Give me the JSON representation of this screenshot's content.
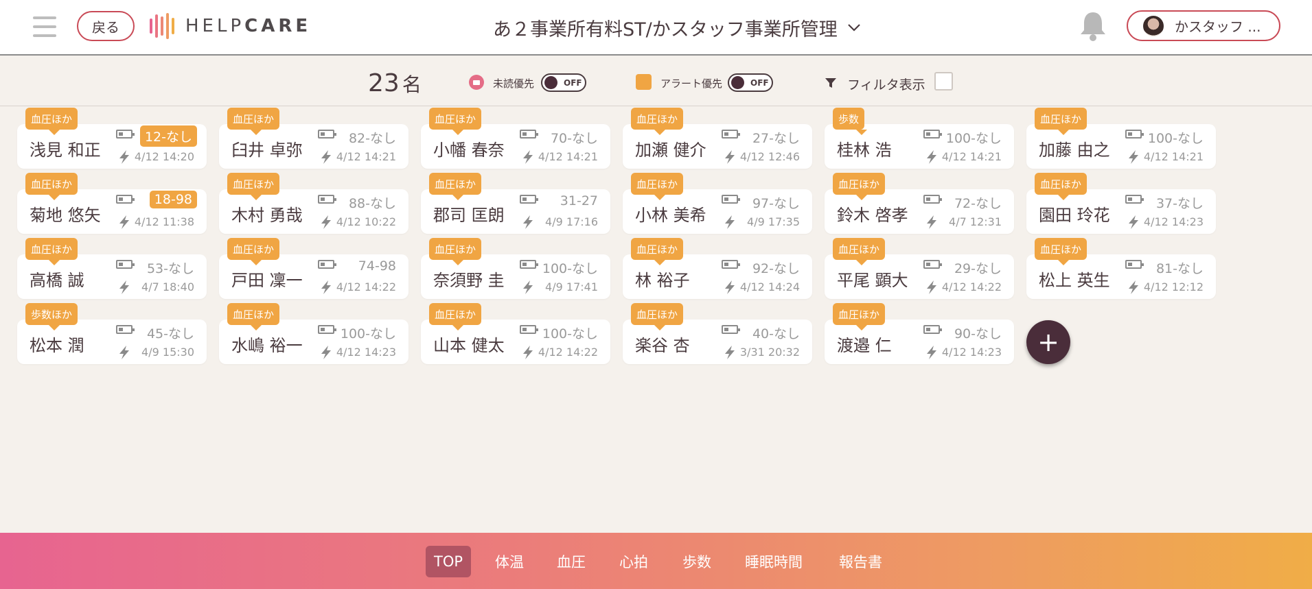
{
  "header": {
    "back_label": "戻る",
    "logo_text_light": "HELP",
    "logo_text_bold": "CARE",
    "facility_name": "あ２事業所有料ST/かスタッフ事業所管理",
    "user_name": "かスタッフ ...",
    "icons": [
      "menu-icon",
      "bell-icon",
      "chevron-down-icon"
    ]
  },
  "filters": {
    "count": "23",
    "count_unit": "名",
    "unread_label": "未読優先",
    "unread_toggle": "OFF",
    "alert_label": "アラート優先",
    "alert_toggle": "OFF",
    "filter_label": "フィルタ表示"
  },
  "colors": {
    "accent": "#f0a543",
    "brand_dark": "#4a2d3a",
    "border_red": "#c94a56",
    "gradient_start": "#e76490",
    "gradient_end": "#f0ad47"
  },
  "residents": [
    {
      "tag": "血圧ほか",
      "name": "浅見 和正",
      "bp": "12-なし",
      "time": "4/12 14:20",
      "alert": true
    },
    {
      "tag": "血圧ほか",
      "name": "臼井 卓弥",
      "bp": "82-なし",
      "time": "4/12 14:21",
      "alert": false
    },
    {
      "tag": "血圧ほか",
      "name": "小幡 春奈",
      "bp": "70-なし",
      "time": "4/12 14:21",
      "alert": false
    },
    {
      "tag": "血圧ほか",
      "name": "加瀬 健介",
      "bp": "27-なし",
      "time": "4/12 12:46",
      "alert": false
    },
    {
      "tag": "歩数",
      "name": "桂林 浩",
      "bp": "100-なし",
      "time": "4/12 14:21",
      "alert": false
    },
    {
      "tag": "血圧ほか",
      "name": "加藤 由之",
      "bp": "100-なし",
      "time": "4/12 14:21",
      "alert": false
    },
    {
      "tag": "血圧ほか",
      "name": "菊地 悠矢",
      "bp": "18-98",
      "time": "4/12 11:38",
      "alert": true
    },
    {
      "tag": "血圧ほか",
      "name": "木村 勇哉",
      "bp": "88-なし",
      "time": "4/12 10:22",
      "alert": false
    },
    {
      "tag": "血圧ほか",
      "name": "郡司 匡朗",
      "bp": "31-27",
      "time": "4/9 17:16",
      "alert": false
    },
    {
      "tag": "血圧ほか",
      "name": "小林 美希",
      "bp": "97-なし",
      "time": "4/9 17:35",
      "alert": false
    },
    {
      "tag": "血圧ほか",
      "name": "鈴木 啓孝",
      "bp": "72-なし",
      "time": "4/7 12:31",
      "alert": false
    },
    {
      "tag": "血圧ほか",
      "name": "園田 玲花",
      "bp": "37-なし",
      "time": "4/12 14:23",
      "alert": false
    },
    {
      "tag": "血圧ほか",
      "name": "高橋 誠",
      "bp": "53-なし",
      "time": "4/7 18:40",
      "alert": false
    },
    {
      "tag": "血圧ほか",
      "name": "戸田 凜一",
      "bp": "74-98",
      "time": "4/12 14:22",
      "alert": false
    },
    {
      "tag": "血圧ほか",
      "name": "奈須野 圭",
      "bp": "100-なし",
      "time": "4/9 17:41",
      "alert": false
    },
    {
      "tag": "血圧ほか",
      "name": "林 裕子",
      "bp": "92-なし",
      "time": "4/12 14:24",
      "alert": false
    },
    {
      "tag": "血圧ほか",
      "name": "平尾 顕大",
      "bp": "29-なし",
      "time": "4/12 14:22",
      "alert": false
    },
    {
      "tag": "血圧ほか",
      "name": "松上 英生",
      "bp": "81-なし",
      "time": "4/12 12:12",
      "alert": false
    },
    {
      "tag": "歩数ほか",
      "name": "松本 潤",
      "bp": "45-なし",
      "time": "4/9 15:30",
      "alert": false
    },
    {
      "tag": "血圧ほか",
      "name": "水嶋 裕一",
      "bp": "100-なし",
      "time": "4/12 14:23",
      "alert": false
    },
    {
      "tag": "血圧ほか",
      "name": "山本 健太",
      "bp": "100-なし",
      "time": "4/12 14:22",
      "alert": false
    },
    {
      "tag": "血圧ほか",
      "name": "楽谷 杏",
      "bp": "40-なし",
      "time": "3/31 20:32",
      "alert": false
    },
    {
      "tag": "血圧ほか",
      "name": "渡邉 仁",
      "bp": "90-なし",
      "time": "4/12 14:23",
      "alert": false
    }
  ],
  "fab_label": "+",
  "bottom_nav": [
    {
      "label": "TOP",
      "active": true
    },
    {
      "label": "体温",
      "active": false
    },
    {
      "label": "血圧",
      "active": false
    },
    {
      "label": "心拍",
      "active": false
    },
    {
      "label": "歩数",
      "active": false
    },
    {
      "label": "睡眠時間",
      "active": false
    },
    {
      "label": "報告書",
      "active": false
    }
  ]
}
